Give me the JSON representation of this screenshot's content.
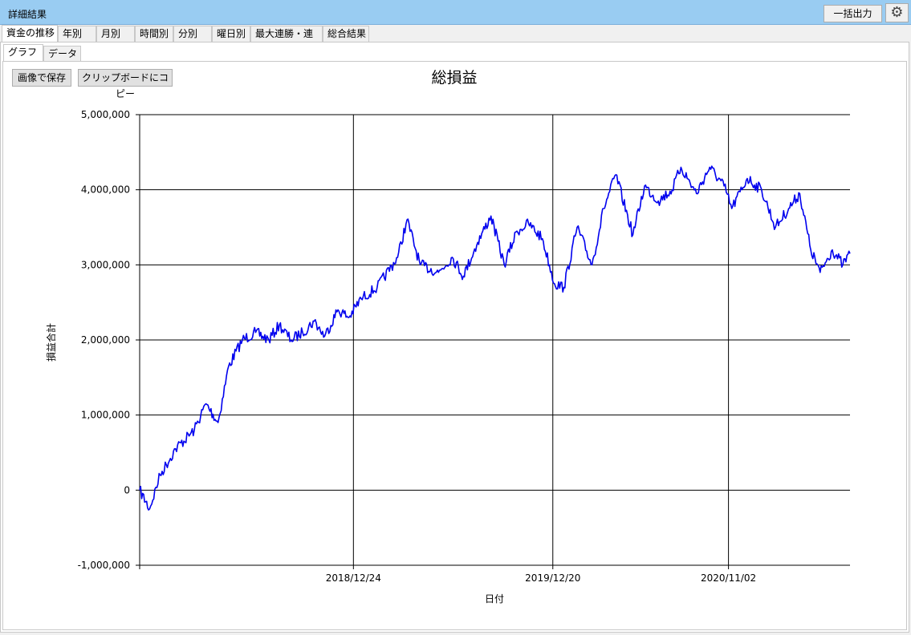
{
  "window": {
    "title": "詳細結果"
  },
  "toolbar": {
    "export_label": "一括出力",
    "settings_icon": "⚙"
  },
  "main_tabs": [
    {
      "label": "資金の推移",
      "active": true
    },
    {
      "label": "年別"
    },
    {
      "label": "月別"
    },
    {
      "label": "時間別"
    },
    {
      "label": "分別"
    },
    {
      "label": "曜日別"
    },
    {
      "label": "最大連勝・連敗"
    },
    {
      "label": "総合結果"
    }
  ],
  "sub_tabs": [
    {
      "label": "グラフ",
      "active": true
    },
    {
      "label": "データ"
    }
  ],
  "buttons": {
    "save_image": "画像で保存",
    "copy_clipboard": "クリップボードにコピー"
  },
  "colors": {
    "titlebar": "#99ccf2",
    "series": "#0000ee"
  },
  "chart_data": {
    "type": "line",
    "title": "総損益",
    "xlabel": "日付",
    "ylabel": "損益合計",
    "ylim": [
      -1000000,
      5000000
    ],
    "yticks": [
      -1000000,
      0,
      1000000,
      2000000,
      3000000,
      4000000,
      5000000
    ],
    "ytick_labels": [
      "-1,000,000",
      "0",
      "1,000,000",
      "2,000,000",
      "3,000,000",
      "4,000,000",
      "5,000,000"
    ],
    "xlim": [
      "2017-12-02",
      "2021-06-10"
    ],
    "xticks": [
      "2018-12-24",
      "2019-12-20",
      "2020-11-02"
    ],
    "xtick_labels": [
      "2018/12/24",
      "2019/12/20",
      "2020/11/02"
    ],
    "grid": true,
    "series": [
      {
        "color": "#0000ee",
        "x": [
          "2017-12-02",
          "2017-12-20",
          "2018-01-08",
          "2018-02-05",
          "2018-03-11",
          "2018-04-01",
          "2018-04-23",
          "2018-05-12",
          "2018-06-06",
          "2018-06-30",
          "2018-07-24",
          "2018-08-12",
          "2018-09-02",
          "2018-09-23",
          "2018-10-14",
          "2018-11-02",
          "2018-11-26",
          "2018-12-16",
          "2019-01-07",
          "2019-02-05",
          "2019-03-14",
          "2019-03-31",
          "2019-04-24",
          "2019-05-27",
          "2019-06-21",
          "2019-07-11",
          "2019-08-06",
          "2019-08-30",
          "2019-09-23",
          "2019-10-16",
          "2019-11-06",
          "2019-12-01",
          "2019-12-23",
          "2020-01-09",
          "2020-02-02",
          "2020-02-29",
          "2020-03-21",
          "2020-04-12",
          "2020-05-13",
          "2020-06-03",
          "2020-06-28",
          "2020-07-23",
          "2020-08-08",
          "2020-09-05",
          "2020-09-29",
          "2020-10-25",
          "2020-11-08",
          "2020-12-06",
          "2021-01-01",
          "2021-01-26",
          "2021-02-19",
          "2021-03-11",
          "2021-03-31",
          "2021-04-17",
          "2021-05-09",
          "2021-05-28",
          "2021-06-10"
        ],
        "y": [
          0,
          -250000,
          200000,
          550000,
          800000,
          1150000,
          900000,
          1650000,
          2000000,
          2100000,
          2000000,
          2200000,
          2000000,
          2100000,
          2250000,
          2050000,
          2400000,
          2300000,
          2550000,
          2700000,
          3100000,
          3600000,
          3000000,
          2900000,
          3100000,
          2850000,
          3300000,
          3650000,
          3000000,
          3450000,
          3550000,
          3350000,
          2750000,
          2700000,
          3500000,
          3000000,
          3750000,
          4200000,
          3400000,
          4050000,
          3850000,
          4000000,
          4300000,
          3950000,
          4300000,
          4050000,
          3750000,
          4150000,
          4000000,
          3500000,
          3750000,
          3950000,
          3200000,
          2900000,
          3200000,
          3000000,
          3150000
        ]
      }
    ]
  }
}
